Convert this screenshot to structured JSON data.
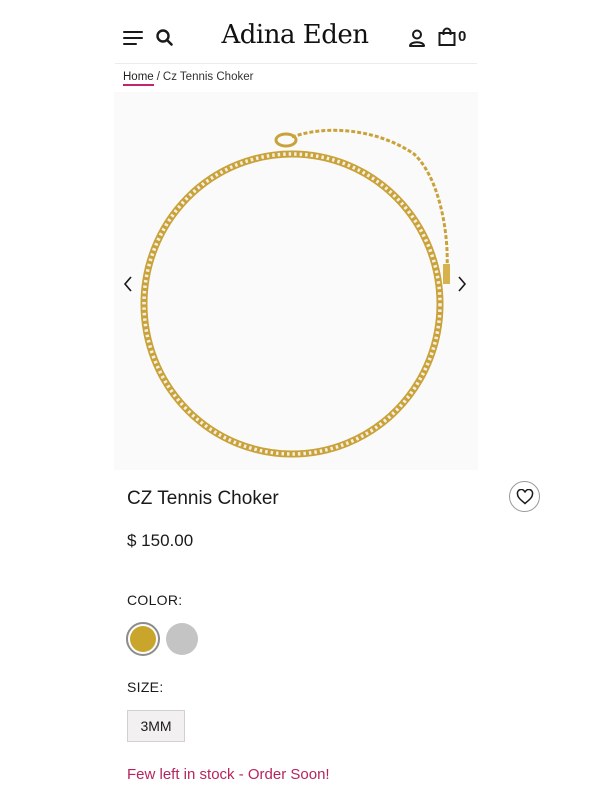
{
  "header": {
    "logo": "Adina Eden",
    "cart_count": "0",
    "icons": {
      "menu": "hamburger-menu-icon",
      "search": "search-icon",
      "account": "user-icon",
      "bag": "shopping-bag-icon"
    }
  },
  "breadcrumb": {
    "home": "Home",
    "separator": "/",
    "current": "Cz Tennis Choker"
  },
  "product": {
    "title": "CZ Tennis Choker",
    "price": "$ 150.00",
    "color_label": "COLOR:",
    "colors": [
      {
        "name": "gold",
        "hex": "#c9a52c",
        "selected": true
      },
      {
        "name": "silver",
        "hex": "#c4c4c4",
        "selected": false
      }
    ],
    "size_label": "SIZE:",
    "sizes": [
      "3MM"
    ],
    "stock_message": "Few left in stock - Order Soon!"
  },
  "colors": {
    "accent": "#c0266d",
    "stock_text": "#b7245f"
  }
}
